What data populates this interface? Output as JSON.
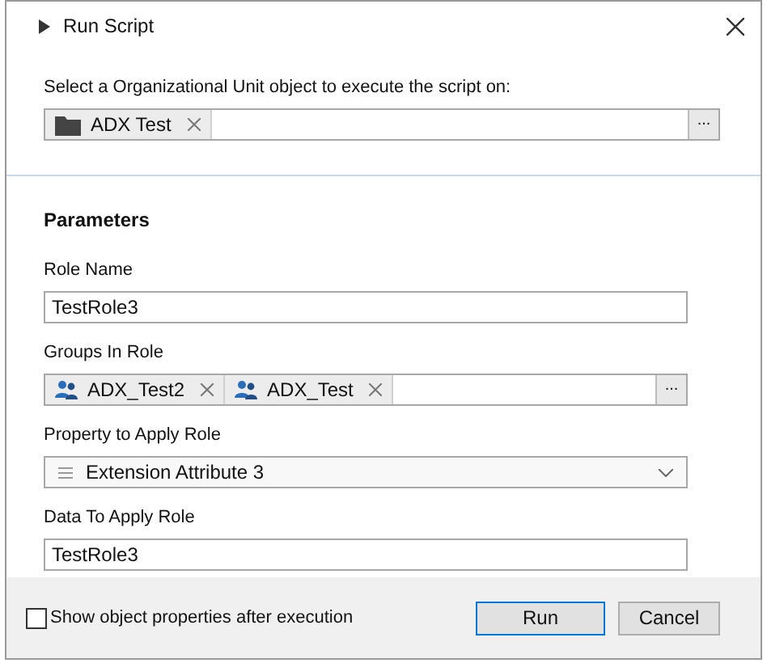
{
  "window": {
    "title": "Run Script"
  },
  "target": {
    "label": "Select a Organizational Unit object to execute the script on:",
    "items": [
      {
        "text": "ADX Test",
        "kind": "folder"
      }
    ],
    "browse": "..."
  },
  "parameters": {
    "heading": "Parameters",
    "fields": [
      {
        "kind": "text",
        "label": "Role Name",
        "value": "TestRole3"
      },
      {
        "kind": "chips",
        "label": "Groups In Role",
        "items": [
          {
            "text": "ADX_Test2",
            "kind": "group"
          },
          {
            "text": "ADX_Test",
            "kind": "group"
          }
        ],
        "browse": "..."
      },
      {
        "kind": "select",
        "label": "Property to Apply Role",
        "value": "Extension Attribute 3"
      },
      {
        "kind": "text",
        "label": "Data To Apply Role",
        "value": "TestRole3"
      }
    ]
  },
  "footer": {
    "checkbox": {
      "label": "Show object properties after execution",
      "checked": false
    },
    "buttons": [
      {
        "label": "Run",
        "selected": true
      },
      {
        "label": "Cancel",
        "selected": false
      }
    ]
  }
}
